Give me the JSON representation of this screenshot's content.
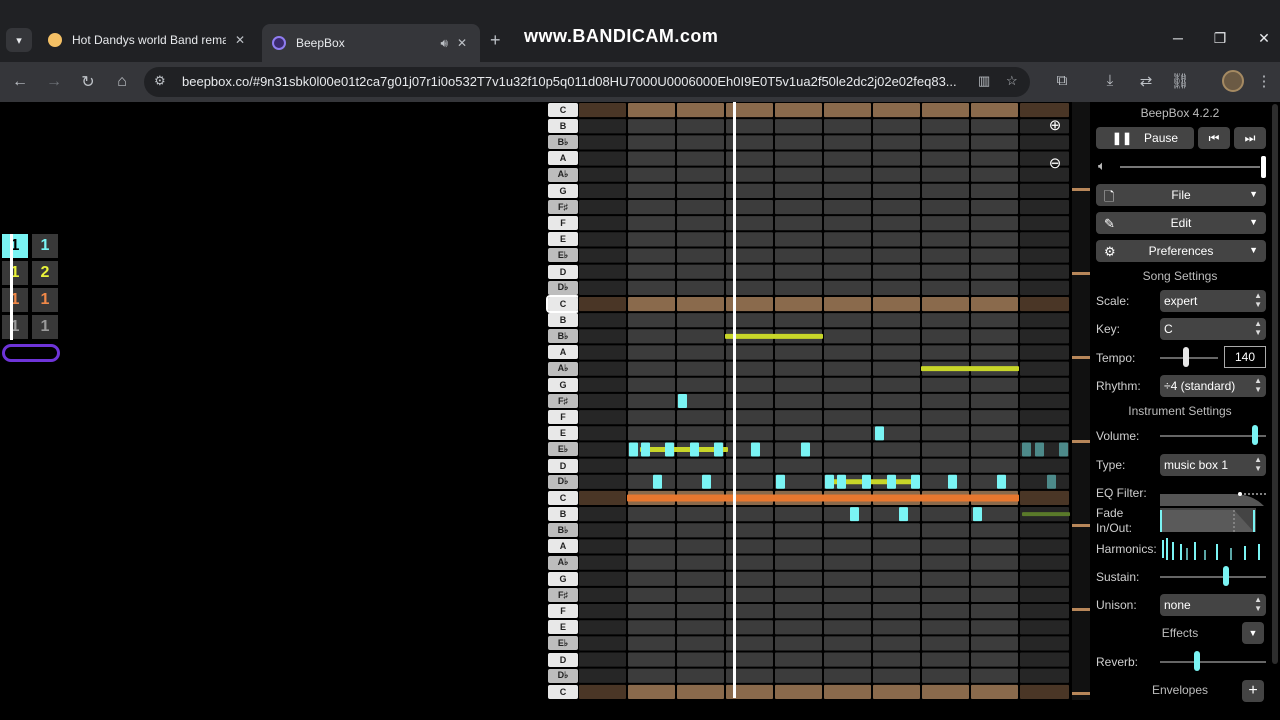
{
  "browser": {
    "tabs": [
      {
        "title": "Hot Dandys world Band remaste",
        "favicon": "face-favicon-icon",
        "active": false
      },
      {
        "title": "BeepBox",
        "favicon": "beepbox-favicon-icon",
        "active": true
      }
    ],
    "watermark": "www.BANDICAM.com",
    "url": "beepbox.co/#9n31sbk0l00e01t2ca7g01j07r1i0o532T7v1u32f10p5q011d08HU7000U0006000Eh0I9E0T5v1ua2f50le2dc2j02e02feq83..."
  },
  "patterns": {
    "rows": [
      [
        {
          "text": "1",
          "color": "#000000",
          "bg": "#7af4f4"
        },
        {
          "text": "1",
          "color": "#7af4f4",
          "bg": "#393939"
        }
      ],
      [
        {
          "text": "1",
          "color": "#eaf43a",
          "bg": "#393939"
        },
        {
          "text": "2",
          "color": "#eaf43a",
          "bg": "#393939"
        }
      ],
      [
        {
          "text": "1",
          "color": "#f08848",
          "bg": "#393939"
        },
        {
          "text": "1",
          "color": "#f08848",
          "bg": "#393939"
        }
      ],
      [
        {
          "text": "1",
          "color": "#9a9a9a",
          "bg": "#393939"
        },
        {
          "text": "1",
          "color": "#9a9a9a",
          "bg": "#393939"
        }
      ]
    ]
  },
  "piano": {
    "keys": [
      "C",
      "B",
      "B♭",
      "A",
      "A♭",
      "G",
      "F♯",
      "F",
      "E",
      "E♭",
      "D",
      "D♭",
      "C",
      "B",
      "B♭",
      "A",
      "A♭",
      "G",
      "F♯",
      "F",
      "E",
      "E♭",
      "D",
      "D♭",
      "C",
      "B",
      "B♭",
      "A",
      "A♭",
      "G",
      "F♯",
      "F",
      "E",
      "E♭",
      "D",
      "D♭",
      "C"
    ]
  },
  "colors": {
    "cyan": "#7af4f4",
    "yellow": "#c8d629",
    "orange": "#e8772e",
    "drum": "#5a7a2a",
    "octave_row": "#8a6a4c",
    "panel_button": "#444444",
    "slider_thumb": "#7af4f4"
  },
  "panel": {
    "version": "BeepBox 4.2.2",
    "pause_label": "Pause",
    "file_label": "File",
    "edit_label": "Edit",
    "preferences_label": "Preferences",
    "song_settings_title": "Song Settings",
    "scale_label": "Scale:",
    "scale_value": "expert",
    "key_label": "Key:",
    "key_value": "C",
    "tempo_label": "Tempo:",
    "tempo_value": "140",
    "rhythm_label": "Rhythm:",
    "rhythm_value": "÷4 (standard)",
    "instrument_settings_title": "Instrument Settings",
    "volume_label": "Volume:",
    "type_label": "Type:",
    "type_value": "music box 1",
    "eq_label": "EQ Filter:",
    "fade_label": "Fade In/Out:",
    "harmonics_label": "Harmonics:",
    "sustain_label": "Sustain:",
    "unison_label": "Unison:",
    "unison_value": "none",
    "effects_label": "Effects",
    "reverb_label": "Reverb:",
    "envelopes_label": "Envelopes",
    "tempo_level": 0.45,
    "volume_level": 0.9,
    "sustain_level": 0.62,
    "reverb_level": 0.35
  }
}
